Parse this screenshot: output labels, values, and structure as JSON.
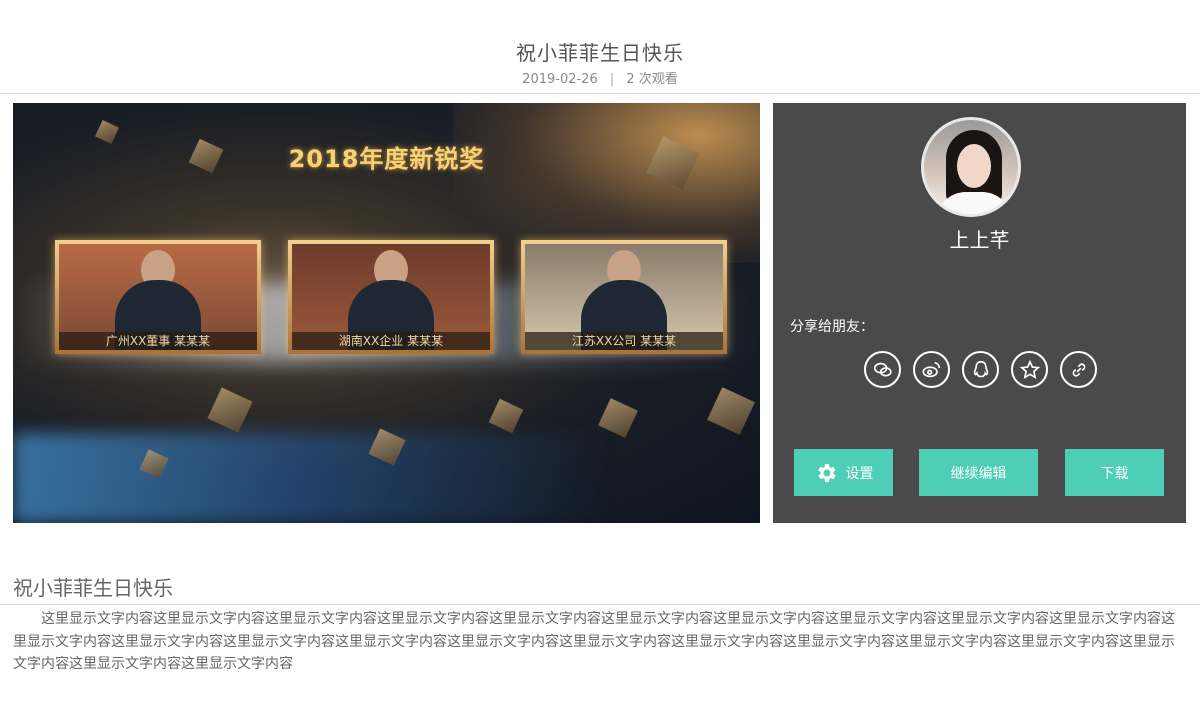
{
  "header": {
    "title": "祝小菲菲生日快乐",
    "date": "2019-02-26",
    "separator": "|",
    "views": "2 次观看"
  },
  "video": {
    "title_text": "2018年度新锐奖",
    "cards": [
      {
        "caption": "广州XX董事 某某某"
      },
      {
        "caption": "湖南XX企业 某某某"
      },
      {
        "caption": "江苏XX公司 某某某"
      }
    ]
  },
  "panel": {
    "username": "上上芊",
    "share_label": "分享给朋友：",
    "share_icons": [
      "wechat-icon",
      "weibo-icon",
      "qq-icon",
      "qzone-icon",
      "link-icon"
    ],
    "buttons": {
      "settings": "设置",
      "continue_edit": "继续编辑",
      "download": "下载"
    }
  },
  "content": {
    "title": "祝小菲菲生日快乐",
    "body": "这里显示文字内容这里显示文字内容这里显示文字内容这里显示文字内容这里显示文字内容这里显示文字内容这里显示文字内容这里显示文字内容这里显示文字内容这里显示文字内容这里显示文字内容这里显示文字内容这里显示文字内容这里显示文字内容这里显示文字内容这里显示文字内容这里显示文字内容这里显示文字内容这里显示文字内容这里显示文字内容这里显示文字内容这里显示文字内容这里显示文字内容"
  },
  "colors": {
    "accent": "#4ecdb7",
    "panel_bg": "#4a4a4a"
  }
}
